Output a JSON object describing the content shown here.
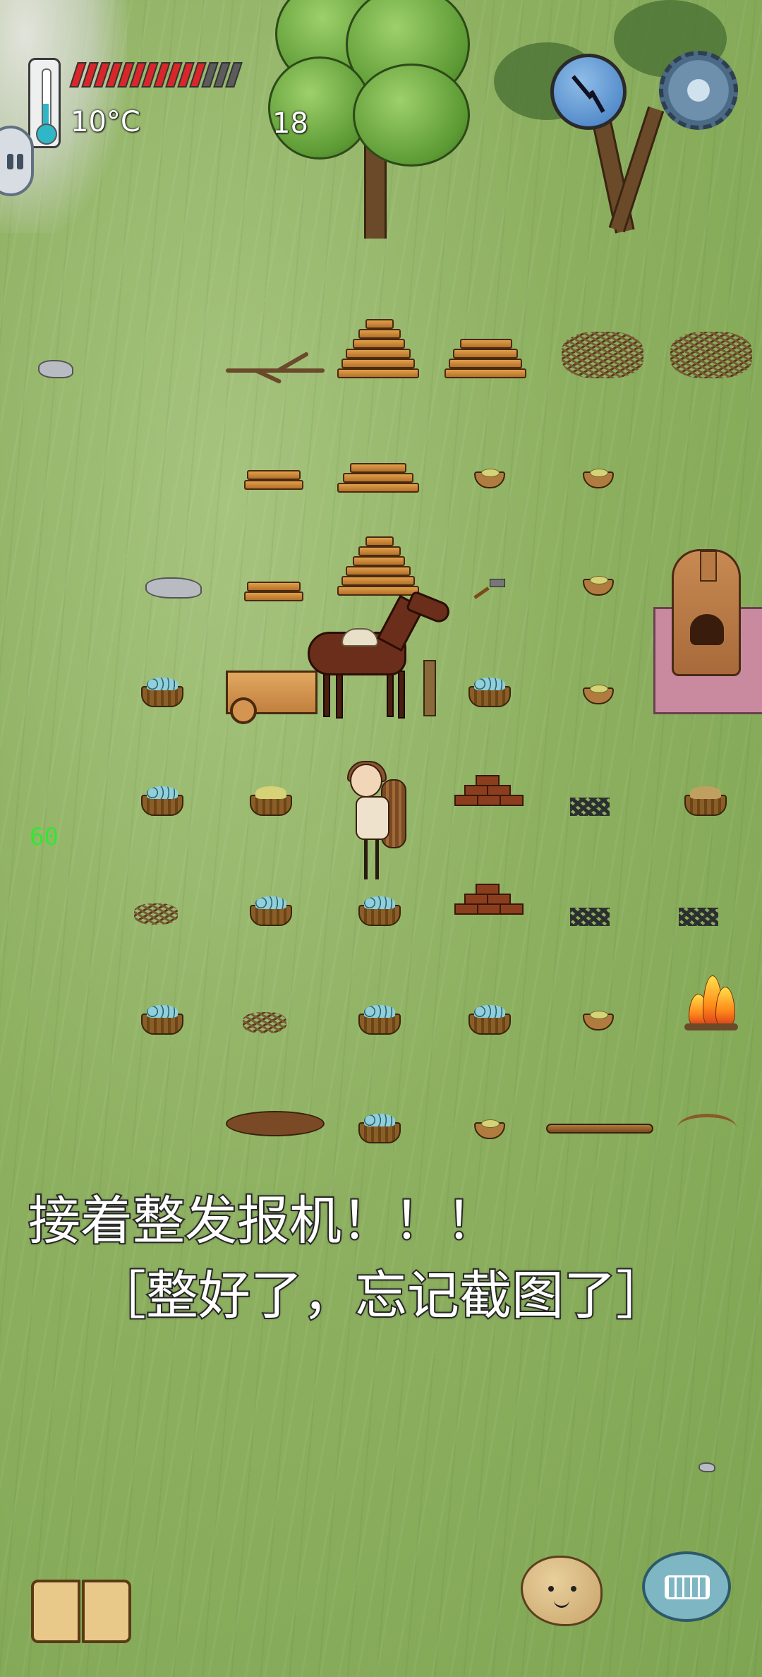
{
  "hud": {
    "temperature": "10°C",
    "age": "18",
    "food_meter": {
      "filled": 11,
      "total": 14
    },
    "fps": "60"
  },
  "caption": {
    "line1": "接着整发报机！！！",
    "line2": "［整好了，忘记截图了］"
  },
  "buttons": {
    "pause": "pause-icon",
    "clock": "compass-clock-icon",
    "settings": "gear-icon",
    "recipe_book": "book-icon",
    "emote": "emote-face-icon",
    "chat": "keyboard-icon"
  },
  "colors": {
    "grass": "#8db060",
    "food_full": "#d9262a",
    "fps_text": "#35e535",
    "kiln_mat": "#c98aa0"
  }
}
